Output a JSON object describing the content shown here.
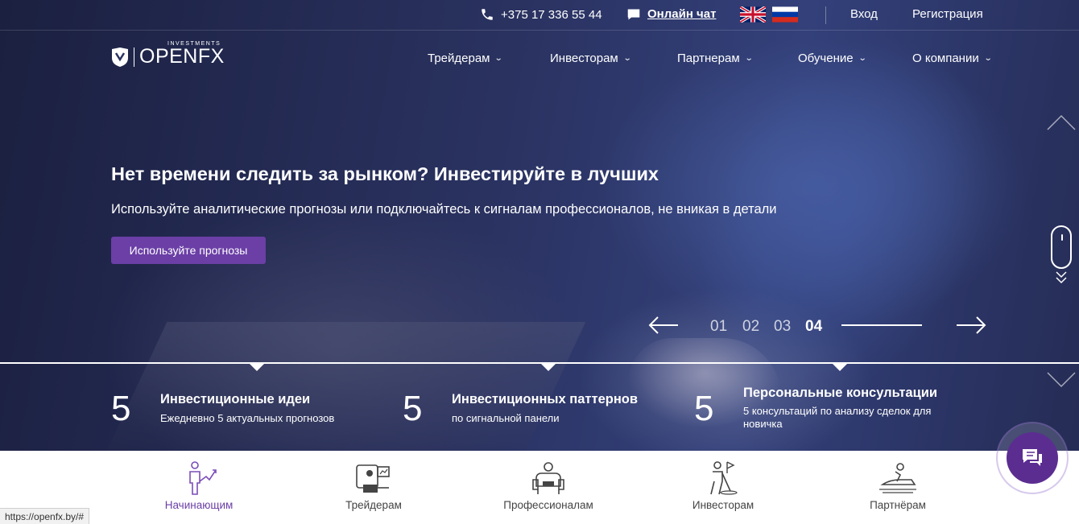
{
  "colors": {
    "accent": "#6b3fa6",
    "chat_button": "#5b2d91",
    "hero_bg": "#2a3260"
  },
  "topbar": {
    "phone": "+375 17 336 55 44",
    "phone_icon": "phone-icon",
    "chat_label": "Онлайн чат",
    "chat_icon": "chat-bubble-icon",
    "lang_en": "english-flag-icon",
    "lang_ru": "russian-flag-icon",
    "login": "Вход",
    "register": "Регистрация"
  },
  "logo": {
    "brand": "OPENFX",
    "tagline": "INVESTMENTS"
  },
  "nav": [
    {
      "label": "Трейдерам"
    },
    {
      "label": "Инвесторам"
    },
    {
      "label": "Партнерам"
    },
    {
      "label": "Обучение"
    },
    {
      "label": "О компании"
    }
  ],
  "hero": {
    "title": "Нет времени следить за рынком? Инвестируйте в лучших",
    "subtitle": "Используйте аналитические прогнозы или подключайтесь к сигналам профессионалов, не вникая в детали",
    "cta": "Используйте прогнозы"
  },
  "slider": {
    "slides": [
      "01",
      "02",
      "03",
      "04"
    ],
    "active": "04"
  },
  "stats": [
    {
      "number": "5",
      "title": "Инвестиционные идеи",
      "desc": "Ежедневно 5 актуальных прогнозов"
    },
    {
      "number": "5",
      "title": "Инвестиционных паттернов",
      "desc": "по сигнальной панели"
    },
    {
      "number": "5",
      "title": "Персональные консультации",
      "desc": "5 консультаций по анализу сделок для новичка"
    }
  ],
  "audience": [
    {
      "label": "Начинающим",
      "icon": "beginner-growth-icon",
      "active": true
    },
    {
      "label": "Трейдерам",
      "icon": "trader-desk-icon",
      "active": false
    },
    {
      "label": "Профессионалам",
      "icon": "professional-armchair-icon",
      "active": false
    },
    {
      "label": "Инвесторам",
      "icon": "investor-golf-icon",
      "active": false
    },
    {
      "label": "Партнёрам",
      "icon": "partner-jetski-icon",
      "active": false
    }
  ],
  "status_url": "https://openfx.by/#"
}
